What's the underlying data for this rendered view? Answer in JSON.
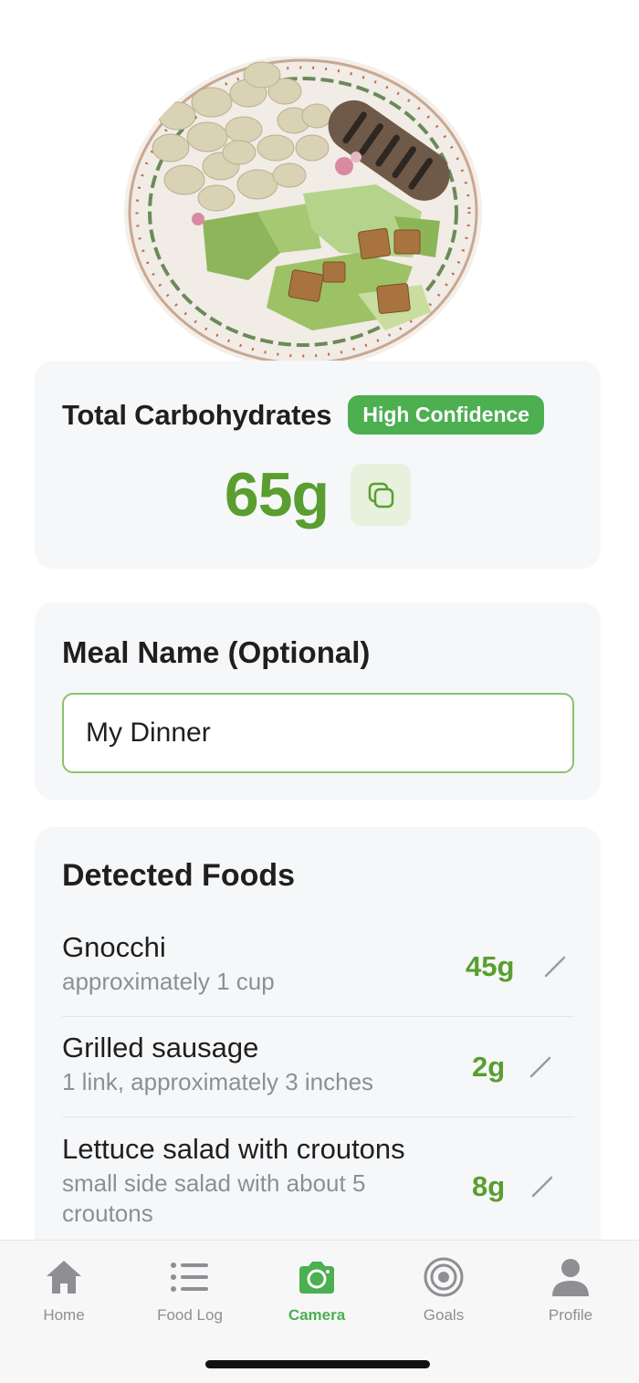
{
  "photo": {
    "alt": "meal-photo"
  },
  "carbs": {
    "title": "Total Carbohydrates",
    "confidence": "High Confidence",
    "value": "65g"
  },
  "meal": {
    "label": "Meal Name (Optional)",
    "value": "My Dinner"
  },
  "foods": {
    "title": "Detected Foods",
    "items": [
      {
        "name": "Gnocchi",
        "desc": "approximately 1 cup",
        "carbs": "45g"
      },
      {
        "name": "Grilled sausage",
        "desc": "1 link, approximately 3 inches",
        "carbs": "2g"
      },
      {
        "name": "Lettuce salad with croutons",
        "desc": "small side salad with about 5 croutons",
        "carbs": "8g"
      }
    ]
  },
  "tabs": [
    {
      "label": "Home",
      "icon": "home-icon"
    },
    {
      "label": "Food Log",
      "icon": "list-icon"
    },
    {
      "label": "Camera",
      "icon": "camera-icon",
      "active": true
    },
    {
      "label": "Goals",
      "icon": "target-icon"
    },
    {
      "label": "Profile",
      "icon": "person-icon"
    }
  ],
  "colors": {
    "accent": "#4caf50",
    "accent_text": "#5a9e2f",
    "card_bg": "#f6f7f9"
  }
}
